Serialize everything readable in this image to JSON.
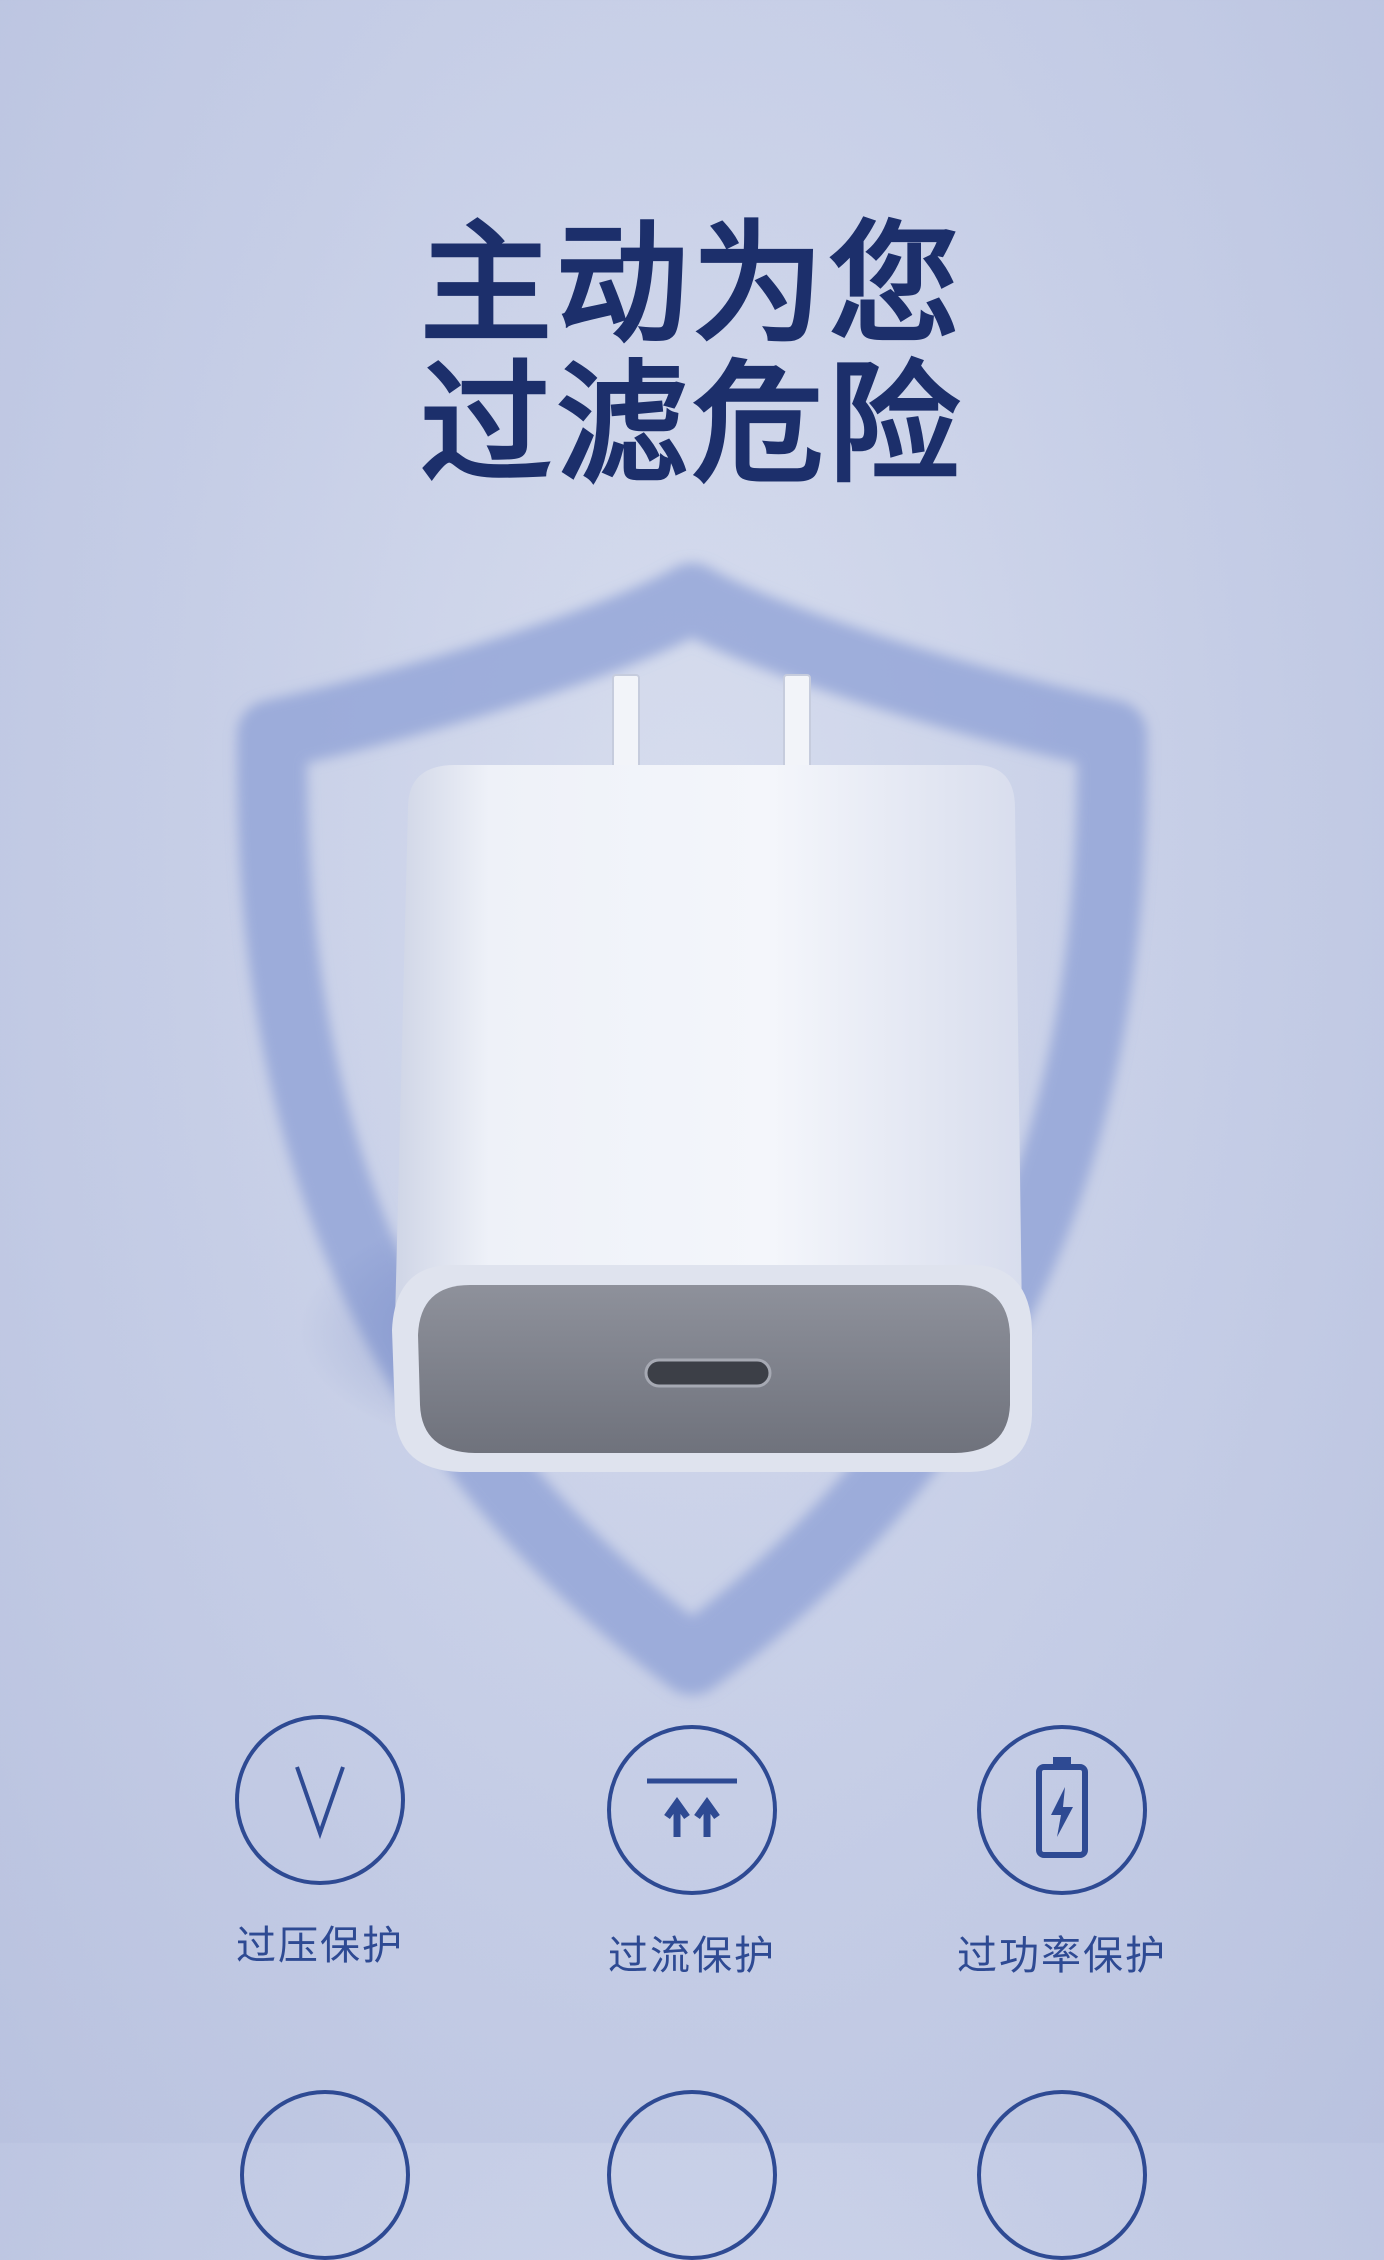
{
  "headline": {
    "line1": "主动为您",
    "line2": "过滤危险"
  },
  "features": [
    {
      "label": "过压保护",
      "icon": "voltage-v-icon"
    },
    {
      "label": "过流保护",
      "icon": "current-arrows-icon"
    },
    {
      "label": "过功率保护",
      "icon": "battery-bolt-icon"
    }
  ],
  "colors": {
    "accent": "#2e4a93",
    "headline": "#1c2f6b",
    "background": "#c9d1e8",
    "shield": "#8ea0d6"
  }
}
